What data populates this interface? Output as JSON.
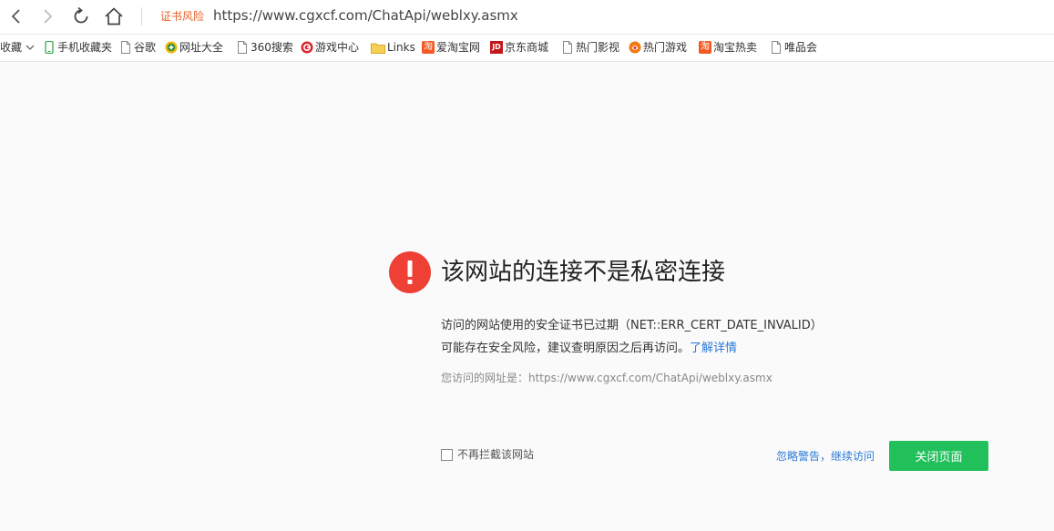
{
  "browser": {
    "cert_risk_label": "证书风险",
    "url": "https://www.cgxcf.com/ChatApi/weblxy.asmx"
  },
  "bookmarks": {
    "folder_label": "收藏",
    "items": [
      {
        "label": "手机收藏夹",
        "icon": "phone-icon"
      },
      {
        "label": "谷歌",
        "icon": "page-icon"
      },
      {
        "label": "网址大全",
        "icon": "directory-icon"
      },
      {
        "label": "360搜索",
        "icon": "page-icon"
      },
      {
        "label": "游戏中心",
        "icon": "game-center-icon"
      },
      {
        "label": "Links",
        "icon": "folder-icon"
      },
      {
        "label": "爱淘宝网",
        "icon": "taobao-icon"
      },
      {
        "label": "京东商城",
        "icon": "jd-icon"
      },
      {
        "label": "热门影视",
        "icon": "page-icon"
      },
      {
        "label": "热门游戏",
        "icon": "hot-games-icon"
      },
      {
        "label": "淘宝热卖",
        "icon": "taobao-icon"
      },
      {
        "label": "唯品会",
        "icon": "page-icon"
      }
    ],
    "taobao_glyph": "淘",
    "jd_glyph": "JD"
  },
  "error": {
    "title": "该网站的连接不是私密连接",
    "desc_line1": "访问的网站使用的安全证书已过期（NET::ERR_CERT_DATE_INVALID）",
    "desc_line2": "可能存在安全风险，建议查明原因之后再访问。",
    "learn_more": "了解详情",
    "site_url_label": "您访问的网址是：https://www.cgxcf.com/ChatApi/weblxy.asmx",
    "dont_block_label": "不再拦截该网站",
    "ignore_link": "忽略警告，继续访问",
    "close_button": "关闭页面"
  },
  "colors": {
    "error_red": "#ef4036",
    "close_green": "#21c05b",
    "link_blue": "#2a7ad8",
    "risk_orange": "#e8622a"
  }
}
